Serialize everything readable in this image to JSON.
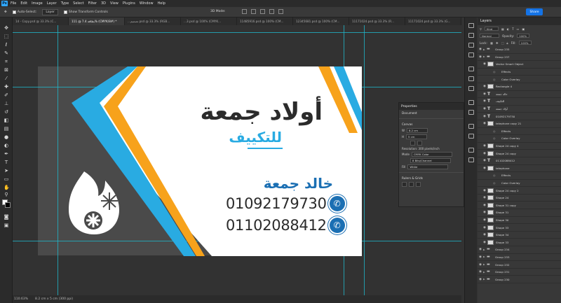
{
  "menubar": {
    "logo": "Ps",
    "items": [
      "File",
      "Edit",
      "Image",
      "Layer",
      "Type",
      "Select",
      "Filter",
      "3D",
      "View",
      "Plugins",
      "Window",
      "Help"
    ]
  },
  "options": {
    "auto_select": "Auto-Select:",
    "layer_select": "Layer",
    "show_transform": "Show Transform Controls",
    "mode_3d": "3D Mode:",
    "share": "Share"
  },
  "tabs": [
    "14 - Copy.psd @ 33.3% (C...",
    "بطاقة 7.4 @ 111% (CMYK/8#) *",
    "...تصميم.psd @ 33.3% (RGB...",
    "...3.psd @ 100% (CMYK...",
    "11485916.psd @ 100% (CM...",
    "12345681.psd @ 100% (CM...",
    "11171024.psd @ 33.3% (R...",
    "11171024.psd @ 33.3% (G..."
  ],
  "card": {
    "title": "أولاد جمعة",
    "subtitle": "للتكييف",
    "name": "خالد جمعة",
    "phone1": "01092179730",
    "phone2": "01102088412",
    "colors": {
      "blue": "#29abe2",
      "orange": "#f7a21b",
      "dark": "#2b2b2b"
    }
  },
  "properties": {
    "tab": "Properties",
    "subtitle": "Document",
    "canvas_section": "Canvas",
    "w_label": "W",
    "w_value": "8.2 cm",
    "h_label": "H",
    "h_value": "5 cm",
    "resolution": "Resolution: 300 pixels/inch",
    "mode_label": "Mode",
    "mode_value": "CMYK Color",
    "bits_value": "8 Bits/Channel",
    "fill_label": "Fill",
    "fill_value": "White",
    "rulers_section": "Rulers & Grids"
  },
  "status": {
    "zoom": "110.63%",
    "size": "8.2 cm x 5 cm (300 ppi)"
  },
  "layers_panel": {
    "title": "Layers",
    "filter_label": "Kind",
    "blend_label": "Normal",
    "opacity_label": "Opacity:",
    "opacity_value": "100%",
    "lock_label": "Lock:",
    "fill_label": "Fill:",
    "fill_value": "100%",
    "items": [
      {
        "name": "Group 235",
        "kind": "folder",
        "indent": 0
      },
      {
        "name": "Group 237",
        "kind": "folder",
        "indent": 0
      },
      {
        "name": "Vector Smart Object",
        "kind": "layer",
        "indent": 1
      },
      {
        "name": "Effects",
        "kind": "fx",
        "indent": 2
      },
      {
        "name": "Color Overlay",
        "kind": "fx",
        "indent": 2
      },
      {
        "name": "Rectangle 4",
        "kind": "layer",
        "indent": 1
      },
      {
        "name": "خالد جمعة",
        "kind": "text",
        "indent": 1
      },
      {
        "name": "للتكييف",
        "kind": "text",
        "indent": 1
      },
      {
        "name": "أولاد جمعة",
        "kind": "text",
        "indent": 1
      },
      {
        "name": "01092179730",
        "kind": "text",
        "indent": 1
      },
      {
        "name": "telephone copy 21",
        "kind": "layer",
        "indent": 1
      },
      {
        "name": "Effects",
        "kind": "fx",
        "indent": 2
      },
      {
        "name": "Color Overlay",
        "kind": "fx",
        "indent": 2
      },
      {
        "name": "Shape 24 copy 4",
        "kind": "layer",
        "indent": 1
      },
      {
        "name": "Shape 24 copy",
        "kind": "layer",
        "indent": 1
      },
      {
        "name": "01102088412",
        "kind": "text",
        "indent": 1
      },
      {
        "name": "telephone",
        "kind": "layer",
        "indent": 1
      },
      {
        "name": "Effects",
        "kind": "fx",
        "indent": 2
      },
      {
        "name": "Color Overlay",
        "kind": "fx",
        "indent": 2
      },
      {
        "name": "Shape 24 copy 2",
        "kind": "layer",
        "indent": 1
      },
      {
        "name": "Shape 24",
        "kind": "layer",
        "indent": 1
      },
      {
        "name": "Shape 31 copy",
        "kind": "layer",
        "indent": 1
      },
      {
        "name": "Shape 31",
        "kind": "layer",
        "indent": 1
      },
      {
        "name": "Shape 30",
        "kind": "layer",
        "indent": 1
      },
      {
        "name": "Shape 33",
        "kind": "layer",
        "indent": 1
      },
      {
        "name": "Shape 34",
        "kind": "layer",
        "indent": 1
      },
      {
        "name": "Shape 33",
        "kind": "layer",
        "indent": 1
      },
      {
        "name": "Group 234",
        "kind": "folder",
        "indent": 0
      },
      {
        "name": "Group 233",
        "kind": "folder",
        "indent": 0
      },
      {
        "name": "Group 232",
        "kind": "folder",
        "indent": 0
      },
      {
        "name": "Group 231",
        "kind": "folder",
        "indent": 0
      },
      {
        "name": "Group 230",
        "kind": "folder",
        "indent": 0
      }
    ]
  }
}
